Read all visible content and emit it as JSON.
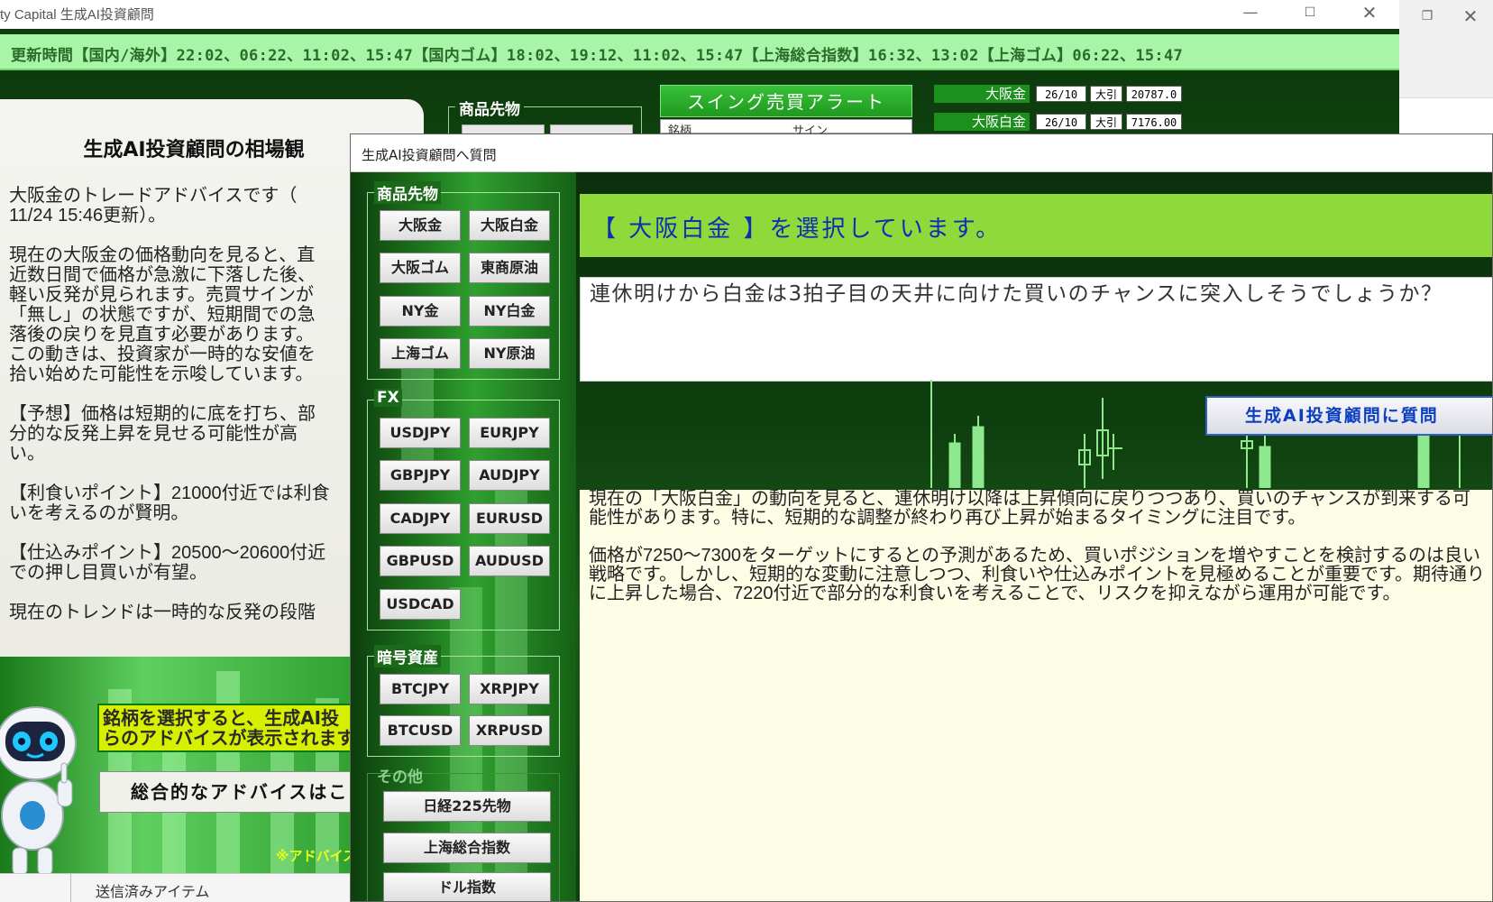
{
  "main_window": {
    "title": "ty Capital 生成AI投資顧問",
    "ticker": "更新時間【国内/海外】22:02、06:22、11:02、15:47【国内ゴム】18:02、19:12、11:02、15:47【上海総合指数】16:32、13:02【上海ゴム】06:22、15:47",
    "group_label": "商品先物",
    "swing_alert": "スイング売買アラート",
    "swing_table_headers": [
      "銘柄",
      "サイン"
    ],
    "quotes": [
      {
        "name": "大阪金",
        "month": "26/10",
        "signal": "大引",
        "price": "20787.0"
      },
      {
        "name": "大阪白金",
        "month": "26/10",
        "signal": "大引",
        "price": "7176.00"
      }
    ]
  },
  "advice_panel": {
    "title": "生成AI投資顧問の相場観",
    "paragraphs": [
      "大阪金のトレードアドバイスです（\n11/24 15:46更新）。",
      "現在の大阪金の価格動向を見ると、直\n近数日間で価格が急激に下落した後、\n軽い反発が見られます。売買サインが\n「無し」の状態ですが、短期間での急\n落後の戻りを見直す必要があります。\nこの動きは、投資家が一時的な安値を\n拾い始めた可能性を示唆しています。",
      "【予想】価格は短期的に底を打ち、部\n分的な反発上昇を見せる可能性が高\nい。",
      "【利食いポイント】21000付近では利食\nいを考えるのが賢明。",
      "【仕込みポイント】20500～20600付近\nでの押し目買いが有望。",
      "現在のトレンドは一時的な反発の段階"
    ],
    "promo_message": "銘柄を選択すると、生成AI投\nらのアドバイスが表示されます",
    "overall_button": "総合的なアドバイスはこ",
    "disclaimer": "※アドバイス"
  },
  "mail_pane": {
    "sent_items": "送信済みアイテム"
  },
  "dialog": {
    "title": "生成AI投資顧問へ質問",
    "groups": {
      "futures": {
        "label": "商品先物",
        "buttons": [
          "大阪金",
          "大阪白金",
          "大阪ゴム",
          "東商原油",
          "NY金",
          "NY白金",
          "上海ゴム",
          "NY原油"
        ]
      },
      "fx": {
        "label": "FX",
        "buttons": [
          "USDJPY",
          "EURJPY",
          "GBPJPY",
          "AUDJPY",
          "CADJPY",
          "EURUSD",
          "GBPUSD",
          "AUDUSD",
          "USDCAD"
        ]
      },
      "crypto": {
        "label": "暗号資産",
        "buttons": [
          "BTCJPY",
          "XRPJPY",
          "BTCUSD",
          "XRPUSD"
        ]
      },
      "other": {
        "label": "その他",
        "buttons": [
          "日経225先物",
          "上海総合指数",
          "ドル指数"
        ]
      }
    },
    "selection_text": "【 大阪白金 】を選択しています。",
    "question": "連休明けから白金は3拍子目の天井に向けた買いのチャンスに突入しそうでしょうか？",
    "ask_button": "生成AI投資顧問に質問",
    "answer_paragraphs": [
      "現在の「大阪白金」の動向を見ると、連休明け以降は上昇傾向に戻りつつあり、買いのチャンスが到来する可能性があります。特に、短期的な調整が終わり再び上昇が始まるタイミングに注目です。",
      "価格が7250～7300をターゲットにするとの予測があるため、買いポジションを増やすことを検討するのは良い戦略です。しかし、短期的な変動に注意しつつ、利食いや仕込みポイントを見極めることが重要です。期待通りに上昇した場合、7220付近で部分的な利食いを考えることで、リスクを抑えながら運用が可能です。"
    ]
  },
  "colors": {
    "ticker_bg": "#a8f5a8",
    "banner_bg": "#8fd93a",
    "selection_text": "#0b2fb5",
    "dark_green": "#0f4a0f"
  }
}
